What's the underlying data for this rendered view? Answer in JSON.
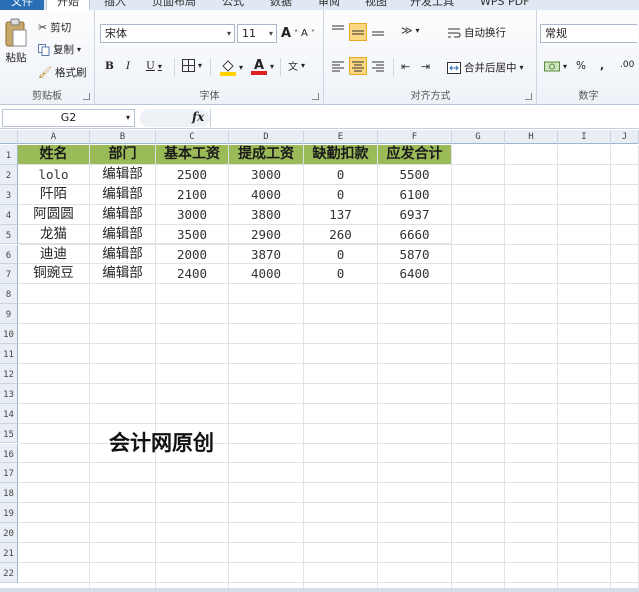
{
  "tabs": [
    "文件",
    "开始",
    "插入",
    "页面布局",
    "公式",
    "数据",
    "审阅",
    "视图",
    "开发工具",
    "WPS PDF"
  ],
  "clipboard": {
    "paste": "粘贴",
    "cut": "剪切",
    "copy": "复制",
    "format_painter": "格式刷",
    "group_label": "剪贴板"
  },
  "font": {
    "name": "宋体",
    "size": "11",
    "bold": "B",
    "italic": "I",
    "underline": "U",
    "grow": "A",
    "shrink": "A",
    "group_label": "字体"
  },
  "alignment": {
    "wrap_text": "自动换行",
    "merge_center": "合并后居中",
    "group_label": "对齐方式"
  },
  "number": {
    "format": "常规",
    "percent": "%",
    "comma": ",",
    "group_label": "数字"
  },
  "formula_bar": {
    "name_box": "G2",
    "fx": "fx",
    "value": ""
  },
  "columns": [
    "A",
    "B",
    "C",
    "D",
    "E",
    "F",
    "G",
    "H",
    "I",
    "J"
  ],
  "rows": [
    "1",
    "2",
    "3",
    "4",
    "5",
    "6",
    "7",
    "8",
    "9",
    "10",
    "11",
    "12",
    "13",
    "14",
    "15",
    "16",
    "17",
    "18",
    "19",
    "20",
    "21",
    "22"
  ],
  "table": {
    "headers": [
      "姓名",
      "部门",
      "基本工资",
      "提成工资",
      "缺勤扣款",
      "应发合计"
    ],
    "rows": [
      [
        "lolo",
        "编辑部",
        "2500",
        "3000",
        "0",
        "5500"
      ],
      [
        "阡陌",
        "编辑部",
        "2100",
        "4000",
        "0",
        "6100"
      ],
      [
        "阿圆圆",
        "编辑部",
        "3000",
        "3800",
        "137",
        "6937"
      ],
      [
        "龙猫",
        "编辑部",
        "3500",
        "2900",
        "260",
        "6660"
      ],
      [
        "迪迪",
        "编辑部",
        "2000",
        "3870",
        "0",
        "5870"
      ],
      [
        "铜豌豆",
        "编辑部",
        "2400",
        "4000",
        "0",
        "6400"
      ]
    ]
  },
  "overlay": "会计网原创",
  "colors": {
    "header_fill": "#9bbb59",
    "highlight": "#fcd980",
    "file_tab": "#2a6eb5"
  }
}
